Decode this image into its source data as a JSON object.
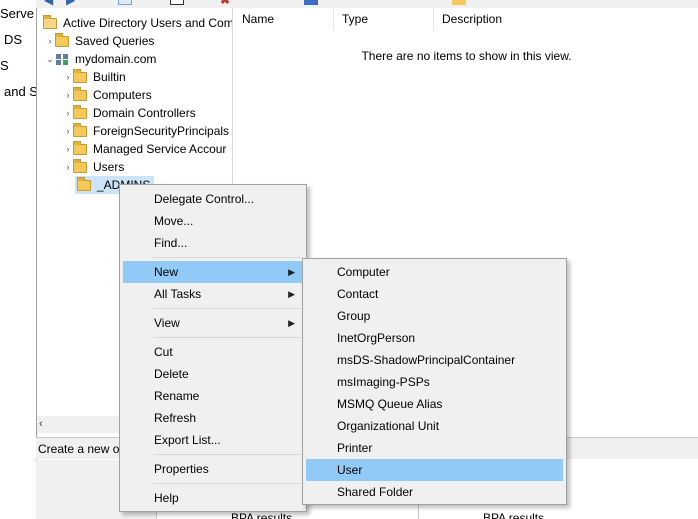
{
  "background": {
    "lines": [
      "Serve",
      "DS",
      "S",
      "and S"
    ]
  },
  "tree": {
    "root": "Active Directory Users and Com",
    "saved_queries": "Saved Queries",
    "domain": "mydomain.com",
    "children": [
      "Builtin",
      "Computers",
      "Domain Controllers",
      "ForeignSecurityPrincipals",
      "Managed Service Accour",
      "Users",
      "_ADMINS"
    ]
  },
  "list": {
    "columns": [
      "Name",
      "Type",
      "Description"
    ],
    "empty_message": "There are no items to show in this view."
  },
  "status_bar": "Create a new ob",
  "bottom": {
    "left_label": "BPA results",
    "right_label": "BPA results"
  },
  "context_menu": {
    "items": [
      "Delegate Control...",
      "Move...",
      "Find...",
      "New",
      "All Tasks",
      "View",
      "Cut",
      "Delete",
      "Rename",
      "Refresh",
      "Export List...",
      "Properties",
      "Help"
    ],
    "highlighted": "New"
  },
  "new_submenu": {
    "items": [
      "Computer",
      "Contact",
      "Group",
      "InetOrgPerson",
      "msDS-ShadowPrincipalContainer",
      "msImaging-PSPs",
      "MSMQ Queue Alias",
      "Organizational Unit",
      "Printer",
      "User",
      "Shared Folder"
    ],
    "highlighted": "User"
  },
  "colors": {
    "highlight": "#91c9f7",
    "menu_bg": "#f0f0f0",
    "folder": "#f4c95a"
  }
}
